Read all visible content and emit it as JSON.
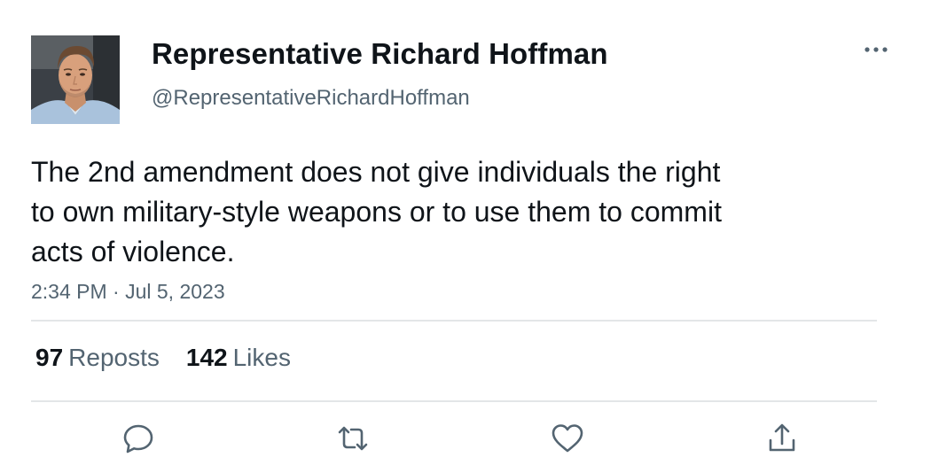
{
  "author": {
    "display_name": "Representative Richard Hoffman",
    "handle": "@RepresentativeRichardHoffman"
  },
  "tweet": {
    "text_lines": [
      "The 2nd amendment does not give individuals the right",
      "to own military-style weapons or to use them to commit",
      "acts of violence."
    ],
    "timestamp": "2:34 PM · Jul 5, 2023"
  },
  "stats": {
    "reposts_count": "97",
    "reposts_label": "Reposts",
    "likes_count": "142",
    "likes_label": "Likes"
  },
  "icons": {
    "more": "more-horizontal-icon",
    "reply": "reply-icon",
    "repost": "repost-icon",
    "like": "heart-icon",
    "share": "share-icon"
  },
  "colors": {
    "text_primary": "#0f1419",
    "text_secondary": "#536471",
    "divider": "#e3e6e8",
    "icon": "#536471"
  }
}
